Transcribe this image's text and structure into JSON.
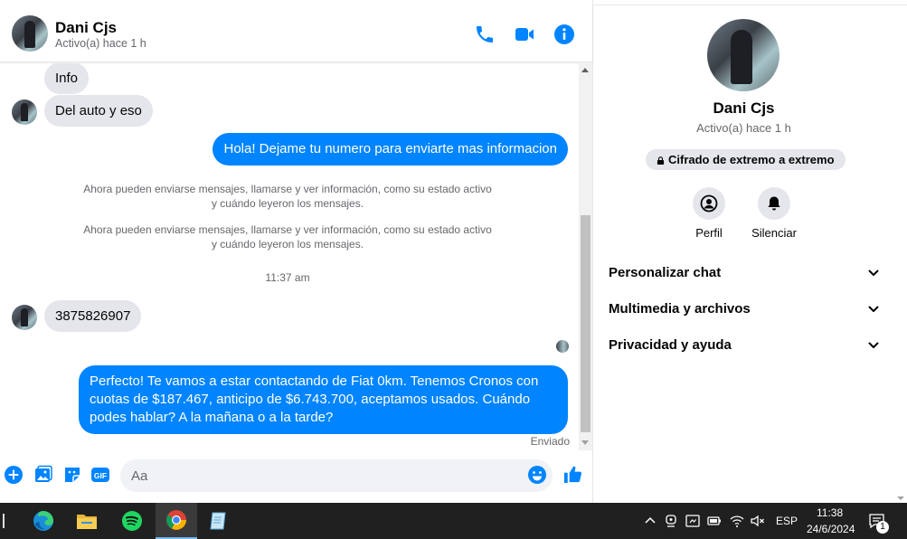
{
  "header": {
    "name": "Dani Cjs",
    "status": "Activo(a) hace 1 h",
    "colors": {
      "accent": "#0084ff"
    }
  },
  "messages": {
    "in_1": "Info",
    "in_2": "Del auto y eso",
    "out_1": "Hola! Dejame tu numero para enviarte mas informacion",
    "sys_1": "Ahora pueden enviarse mensajes, llamarse y ver información, como su estado activo y cuándo leyeron los mensajes.",
    "sys_2": "Ahora pueden enviarse mensajes, llamarse y ver información, como su estado activo y cuándo leyeron los mensajes.",
    "time": "11:37 am",
    "in_3": "3875826907",
    "out_2": "Perfecto! Te vamos a estar contactando de Fiat 0km. Tenemos Cronos con cuotas de $187.467, anticipo de $6.743.700, aceptamos usados. Cuándo podes hablar? A la mañana o a la tarde?",
    "sent_status": "Enviado"
  },
  "composer": {
    "placeholder": "Aa",
    "icons": [
      "plus-icon",
      "image-icon",
      "sticker-icon",
      "gif-icon",
      "emoji-icon",
      "like-icon"
    ]
  },
  "info_panel": {
    "name": "Dani Cjs",
    "status": "Activo(a) hace 1 h",
    "e2e_label": "Cifrado de extremo a extremo",
    "actions": {
      "profile": "Perfil",
      "mute": "Silenciar"
    },
    "sections": {
      "customize": "Personalizar chat",
      "media": "Multimedia y archivos",
      "privacy": "Privacidad y ayuda"
    }
  },
  "taskbar": {
    "apps": [
      "edge-icon",
      "file-explorer-icon",
      "spotify-icon",
      "chrome-icon",
      "notepad-icon"
    ],
    "lang": "ESP",
    "time": "11:38",
    "date": "24/6/2024",
    "notification_count": "1"
  }
}
